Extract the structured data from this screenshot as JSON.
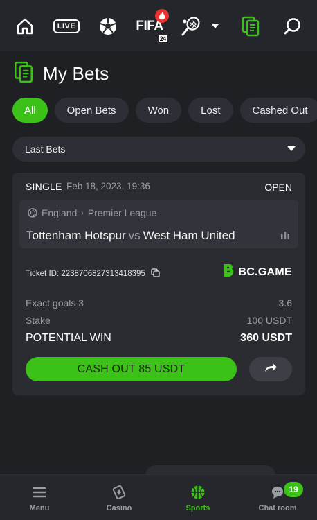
{
  "topnav": {
    "items": [
      "home-icon",
      "live-icon",
      "soccer-ball-icon",
      "fifa-icon",
      "tennis-icon",
      "chevron-down-icon",
      "bets-icon",
      "search-icon"
    ],
    "live_label": "LIVE",
    "fifa_label": "FIFA",
    "fifa_year": "24"
  },
  "header": {
    "title": "My Bets",
    "icon": "bets-icon"
  },
  "filters": {
    "chips": [
      "All",
      "Open Bets",
      "Won",
      "Lost",
      "Cashed Out"
    ],
    "active_index": 0
  },
  "dropdown": {
    "selected": "Last Bets"
  },
  "bet": {
    "type": "SINGLE",
    "date": "Feb 18, 2023, 19:36",
    "status": "OPEN",
    "country": "England",
    "league": "Premier League",
    "home_team": "Tottenham Hotspur",
    "vs": "vs",
    "away_team": "West Ham United",
    "ticket_label": "Ticket ID: 2238706827313418395",
    "brand": "BC.GAME",
    "selection_label": "Exact goals 3",
    "odds": "3.6",
    "stake_label": "Stake",
    "stake_value": "100 USDT",
    "win_label": "POTENTIAL WIN",
    "win_value": "360 USDT",
    "cashout_label": "CASH OUT 85 USDT"
  },
  "bottomnav": {
    "items": [
      {
        "label": "Menu",
        "icon": "menu-icon"
      },
      {
        "label": "Casino",
        "icon": "casino-icon"
      },
      {
        "label": "Sports",
        "icon": "basketball-icon"
      },
      {
        "label": "Chat room",
        "icon": "chat-icon",
        "badge": "19"
      }
    ],
    "active_index": 2
  },
  "colors": {
    "accent": "#3bc117",
    "background": "#1e2024",
    "card": "#2a2c31"
  }
}
